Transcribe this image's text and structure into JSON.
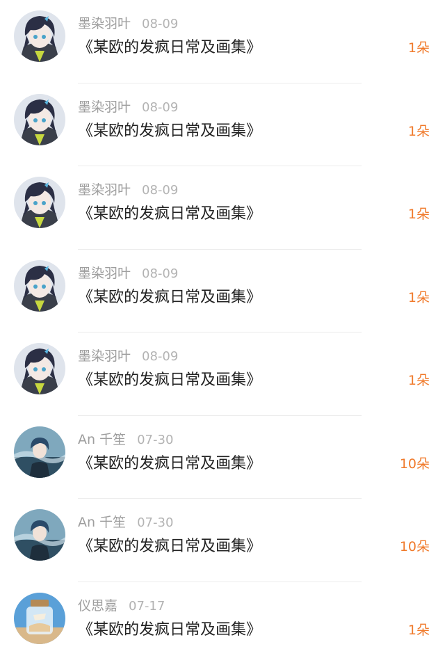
{
  "records": [
    {
      "user": "墨染羽叶",
      "date": "08-09",
      "title": "《某欧的发疯日常及画集》",
      "count": "1朵",
      "avatar_icon": "anime-girl-avatar-icon"
    },
    {
      "user": "墨染羽叶",
      "date": "08-09",
      "title": "《某欧的发疯日常及画集》",
      "count": "1朵",
      "avatar_icon": "anime-girl-avatar-icon"
    },
    {
      "user": "墨染羽叶",
      "date": "08-09",
      "title": "《某欧的发疯日常及画集》",
      "count": "1朵",
      "avatar_icon": "anime-girl-avatar-icon"
    },
    {
      "user": "墨染羽叶",
      "date": "08-09",
      "title": "《某欧的发疯日常及画集》",
      "count": "1朵",
      "avatar_icon": "anime-girl-avatar-icon"
    },
    {
      "user": "墨染羽叶",
      "date": "08-09",
      "title": "《某欧的发疯日常及画集》",
      "count": "1朵",
      "avatar_icon": "anime-girl-avatar-icon"
    },
    {
      "user": "An 千笙",
      "date": "07-30",
      "title": "《某欧的发疯日常及画集》",
      "count": "10朵",
      "avatar_icon": "anime-boy-avatar-icon"
    },
    {
      "user": "An 千笙",
      "date": "07-30",
      "title": "《某欧的发疯日常及画集》",
      "count": "10朵",
      "avatar_icon": "anime-boy-avatar-icon"
    },
    {
      "user": "仪思嘉",
      "date": "07-17",
      "title": "《某欧的发疯日常及画集》",
      "count": "1朵",
      "avatar_icon": "glass-jar-avatar-icon"
    }
  ],
  "colors": {
    "accent": "#f07a2b",
    "meta_text": "#9e9e9e",
    "title_text": "#222222",
    "divider": "#ececec"
  }
}
